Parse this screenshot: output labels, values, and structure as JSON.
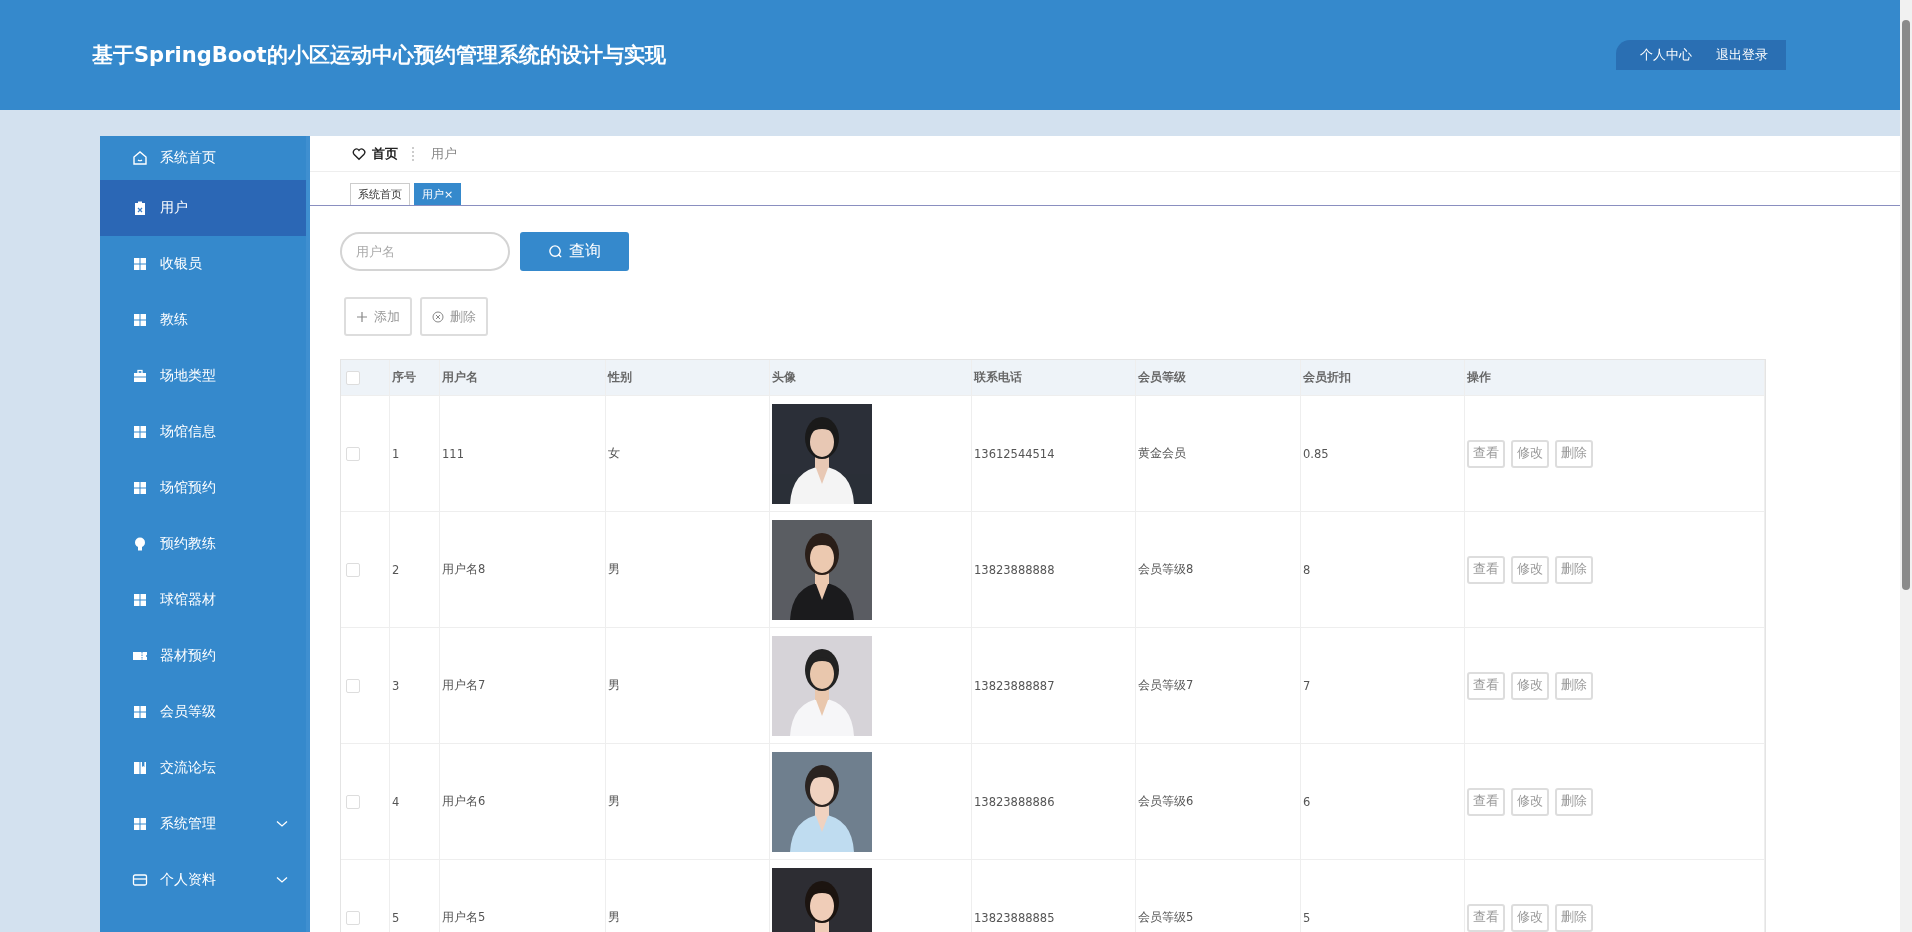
{
  "header": {
    "title": "基于SpringBoot的小区运动中心预约管理系统的设计与实现",
    "links": [
      "个人中心",
      "退出登录"
    ]
  },
  "sidebar": {
    "items": [
      {
        "label": "系统首页",
        "kind": "home",
        "selected": false,
        "expandable": false
      },
      {
        "label": "用户",
        "kind": "clipboard",
        "selected": true,
        "expandable": false
      },
      {
        "label": "收银员",
        "kind": "grid",
        "selected": false,
        "expandable": false
      },
      {
        "label": "教练",
        "kind": "grid",
        "selected": false,
        "expandable": false
      },
      {
        "label": "场地类型",
        "kind": "briefcase",
        "selected": false,
        "expandable": false
      },
      {
        "label": "场馆信息",
        "kind": "grid",
        "selected": false,
        "expandable": false
      },
      {
        "label": "场馆预约",
        "kind": "grid",
        "selected": false,
        "expandable": false
      },
      {
        "label": "预约教练",
        "kind": "bulb",
        "selected": false,
        "expandable": false
      },
      {
        "label": "球馆器材",
        "kind": "grid",
        "selected": false,
        "expandable": false
      },
      {
        "label": "器材预约",
        "kind": "ticket",
        "selected": false,
        "expandable": false
      },
      {
        "label": "会员等级",
        "kind": "grid",
        "selected": false,
        "expandable": false
      },
      {
        "label": "交流论坛",
        "kind": "book",
        "selected": false,
        "expandable": false
      },
      {
        "label": "系统管理",
        "kind": "grid",
        "selected": false,
        "expandable": true
      },
      {
        "label": "个人资料",
        "kind": "card",
        "selected": false,
        "expandable": true
      }
    ]
  },
  "breadcrumb": [
    "首页",
    "用户"
  ],
  "tabs": [
    {
      "label": "系统首页",
      "selected": false
    },
    {
      "label": "用户",
      "selected": true,
      "close": "×"
    }
  ],
  "search": {
    "placeholder": "用户名",
    "button": "查询"
  },
  "actions": [
    "添加",
    "删除"
  ],
  "table": {
    "all_checked": false,
    "columns": [
      "序号",
      "用户名",
      "性别",
      "头像",
      "联系电话",
      "会员等级",
      "会员折扣",
      "操作"
    ],
    "rows": [
      {
        "checked": false,
        "cells": [
          "1",
          "111",
          "女",
          {
            "kind": "picture"
          },
          "13612544514",
          "黄金会员",
          "0.85"
        ],
        "buttons": [
          "查看",
          "修改",
          "删除"
        ]
      },
      {
        "checked": false,
        "cells": [
          "2",
          "用户名8",
          "男",
          {
            "kind": "picture"
          },
          "13823888888",
          "会员等级8",
          "8"
        ],
        "buttons": [
          "查看",
          "修改",
          "删除"
        ]
      },
      {
        "checked": false,
        "cells": [
          "3",
          "用户名7",
          "男",
          {
            "kind": "picture"
          },
          "13823888887",
          "会员等级7",
          "7"
        ],
        "buttons": [
          "查看",
          "修改",
          "删除"
        ]
      },
      {
        "checked": false,
        "cells": [
          "4",
          "用户名6",
          "男",
          {
            "kind": "picture"
          },
          "13823888886",
          "会员等级6",
          "6"
        ],
        "buttons": [
          "查看",
          "修改",
          "删除"
        ]
      },
      {
        "checked": false,
        "cells": [
          "5",
          "用户名5",
          "男",
          {
            "kind": "picture"
          },
          "13823888885",
          "会员等级5",
          "5"
        ],
        "buttons": [
          "查看",
          "修改",
          "删除"
        ]
      }
    ]
  }
}
